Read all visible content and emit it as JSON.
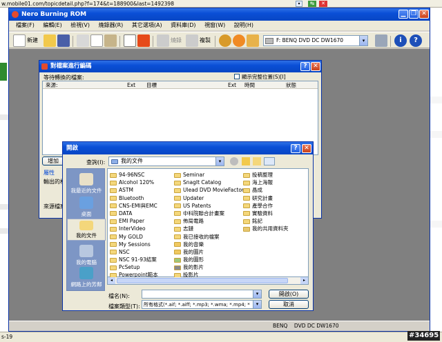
{
  "browser": {
    "url": "w.mobile01.com/topicdetail.php?f=174&t=188900&last=1492398",
    "status_left": "s-19"
  },
  "nero": {
    "title": "Nero Burning ROM",
    "menu": [
      "檔案(F)",
      "編輯(E)",
      "檢視(V)",
      "燒錄器(R)",
      "其它選項(A)",
      "資料庫(D)",
      "視窗(W)",
      "說明(H)"
    ],
    "toolbar": {
      "new_label": "新建",
      "burn_label": "燒錄",
      "copy_label": "複製"
    },
    "drive_select": "F: BENQ  DVD DC DW1670",
    "status_drive": "BENQ    DVD DC DW1670"
  },
  "encode_dialog": {
    "title": "對檔案進行編碼",
    "queue_label": "等待轉換的檔案:",
    "show_full_path": "顯示完整位置(S)[I]",
    "columns": [
      "來源:",
      "Ext",
      "目標",
      "Ext",
      "時間",
      "狀態"
    ],
    "add_button": "增加",
    "properties": "屬性",
    "output_label": "輸出的格",
    "source_label": "來源檔案"
  },
  "open_dialog": {
    "title": "開啟",
    "lookin_label": "查詢(I):",
    "lookin_value": "我的文件",
    "places": [
      "我最近的文件",
      "桌面",
      "我的文件",
      "我的電腦",
      "網路上的芳鄰"
    ],
    "files_col1": [
      "94-96NSC",
      "Alcohol 120%",
      "ASTM",
      "Bluetooth",
      "CNS-EMI與EMC",
      "DATA",
      "EMI Paper",
      "InterVideo",
      "My GOLD",
      "My Sessions",
      "NSC",
      "NSC 91-93結案",
      "PcSetup",
      "Powerpoint範本"
    ],
    "files_col2": [
      "Seminar",
      "SnagIt Catalog",
      "Ulead DVD MovieFactory",
      "Updater",
      "US Patents",
      "中科院聯合計畫案",
      "佈局電路",
      "志鏈",
      "我已接收的檔案",
      "我的音樂",
      "我的圖片",
      "我的圖形",
      "我的影片",
      "投影片"
    ],
    "files_col3": [
      "投稿整理",
      "海上海報",
      "晶成",
      "研究計畫",
      "產學合作",
      "實驗資料",
      "銘記",
      "我的共用資料夾"
    ],
    "filename_label": "檔名(N):",
    "filename_value": "",
    "filetype_label": "檔案類型(T):",
    "filetype_value": "所有格式(*.aif; *.aiff; *.mp3; *.wma; *.mp4; *",
    "open_button": "開啟(O)",
    "cancel_button": "取消"
  },
  "watermark": "#34695",
  "colors": {
    "xp_blue": "#0a4fd6",
    "dialog_face": "#ece9d8",
    "nero_face": "#d4d0c8"
  }
}
